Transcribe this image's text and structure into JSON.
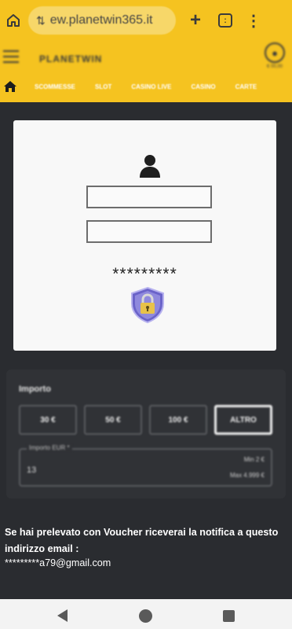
{
  "browser": {
    "url": "ew.planetwin365.it",
    "tab_count": ":",
    "colors": {
      "bar": "#f5c320",
      "pill": "#f7d769"
    }
  },
  "site": {
    "logo_text": "PLANETWIN",
    "balance": "€ 00,00",
    "nav_items": [
      "SCOMMESSE",
      "SLOT",
      "CASINO LIVE",
      "CASINO",
      "CARTE"
    ]
  },
  "login": {
    "masked_password": "*********"
  },
  "amount": {
    "title": "Importo",
    "buttons": [
      "30 €",
      "50 €",
      "100 €",
      "ALTRO"
    ],
    "selected": "ALTRO",
    "input_label": "Importo EUR *",
    "input_value": "13",
    "min": "Min 2 €",
    "max": "Max 4.999 €"
  },
  "info": {
    "message": "Se hai prelevato con Voucher riceverai la notifica a questo indirizzo email :",
    "email": "*********a79@gmail.com"
  },
  "colors": {
    "page_bg": "#2a2c30",
    "panel_bg": "#303236",
    "accent": "#f5c320",
    "shield": "#6a63c9",
    "lock": "#e8c24a"
  }
}
